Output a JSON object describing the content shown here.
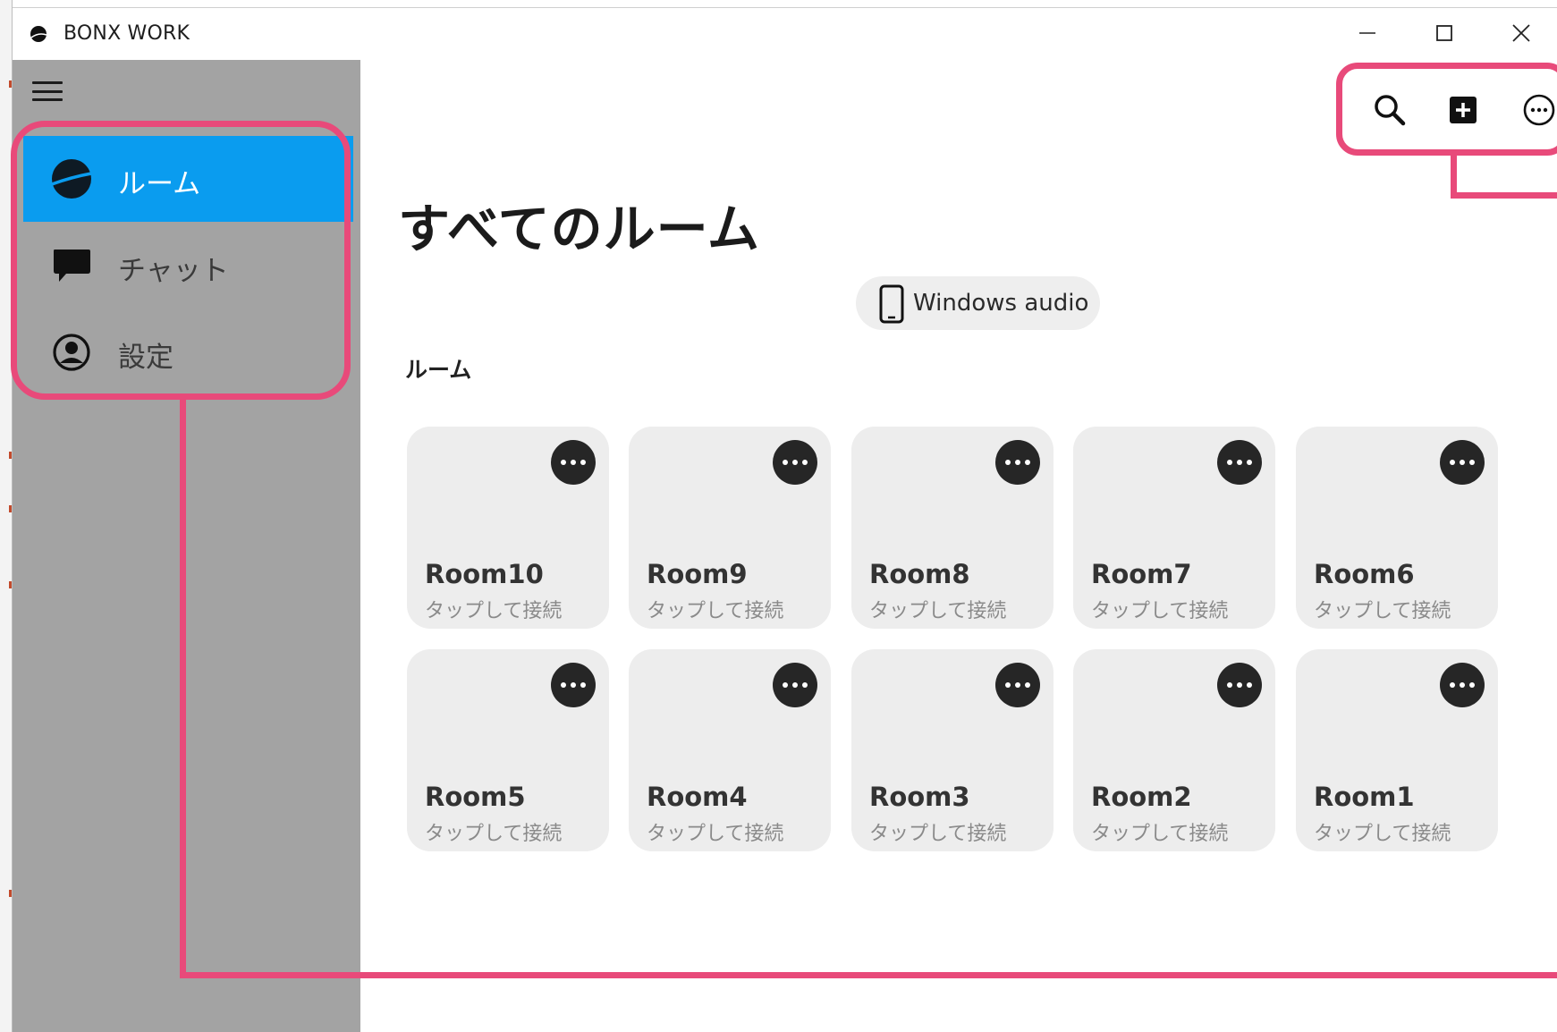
{
  "window": {
    "title": "BONX WORK",
    "controls": {
      "minimize": "minimize-icon",
      "maximize": "maximize-icon",
      "close": "close-icon"
    }
  },
  "sidebar": {
    "menu_icon": "hamburger-icon",
    "items": [
      {
        "label": "ルーム",
        "icon": "rooms-icon",
        "active": true
      },
      {
        "label": "チャット",
        "icon": "chat-bubble-icon",
        "active": false
      },
      {
        "label": "設定",
        "icon": "user-circle-icon",
        "active": false
      }
    ],
    "active_color": "#0a9cef",
    "background": "#a3a3a3"
  },
  "toolbar": {
    "search_icon": "search-icon",
    "add_icon": "add-square-icon",
    "more_icon": "more-circle-icon"
  },
  "main": {
    "title": "すべてのルーム",
    "audio_device": {
      "label": "Windows audio",
      "icon": "phone-icon"
    },
    "section_label": "ルーム",
    "rooms": [
      {
        "name": "Room10",
        "status": "タップして接続"
      },
      {
        "name": "Room9",
        "status": "タップして接続"
      },
      {
        "name": "Room8",
        "status": "タップして接続"
      },
      {
        "name": "Room7",
        "status": "タップして接続"
      },
      {
        "name": "Room6",
        "status": "タップして接続"
      },
      {
        "name": "Room5",
        "status": "タップして接続"
      },
      {
        "name": "Room4",
        "status": "タップして接続"
      },
      {
        "name": "Room3",
        "status": "タップして接続"
      },
      {
        "name": "Room2",
        "status": "タップして接続"
      },
      {
        "name": "Room1",
        "status": "タップして接続"
      }
    ]
  },
  "annotation_color": "#e84a7a"
}
